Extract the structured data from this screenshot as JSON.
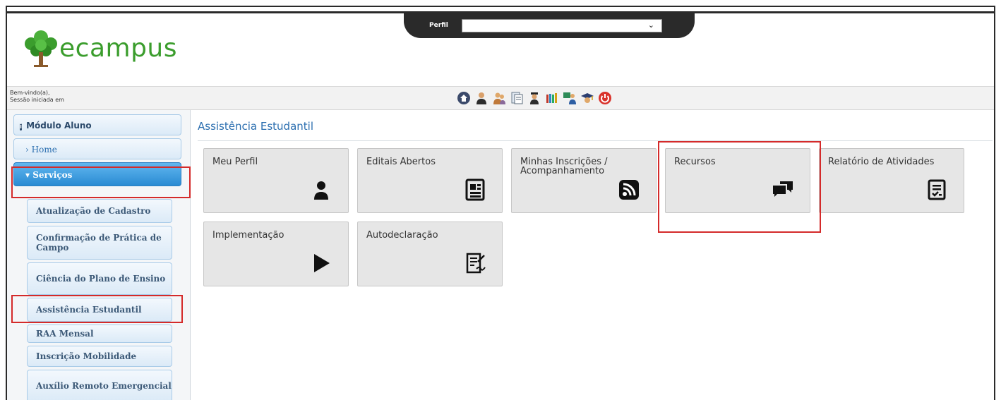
{
  "header": {
    "perfil_label": "Perfil",
    "perfil_value": "",
    "logo_text": "ecampus"
  },
  "welcome": {
    "line1": "Bem-vindo(a),",
    "line2": "Sessão iniciada em"
  },
  "toolbar": {
    "icons": [
      "home-icon",
      "user-icon",
      "users-icon",
      "document-icon",
      "graduate-icon",
      "books-icon",
      "teacher-icon",
      "cap-icon",
      "power-icon"
    ]
  },
  "sidebar": {
    "modulo": "Módulo Aluno",
    "home": "Home",
    "servicos": "Serviços",
    "items": [
      {
        "label": "Atualização de Cadastro"
      },
      {
        "label": "Confirmação de Prática de Campo"
      },
      {
        "label": "Ciência do Plano de Ensino"
      },
      {
        "label": "Assistência Estudantil"
      },
      {
        "label": "RAA Mensal"
      },
      {
        "label": "Inscrição Mobilidade"
      },
      {
        "label": "Auxílio Remoto Emergencial"
      }
    ]
  },
  "main": {
    "title": "Assistência Estudantil",
    "tiles": [
      {
        "label": "Meu Perfil",
        "icon": "person-icon"
      },
      {
        "label": "Editais Abertos",
        "icon": "newspaper-icon"
      },
      {
        "label": "Minhas Inscrições / Acompanhamento",
        "icon": "rss-icon"
      },
      {
        "label": "Recursos",
        "icon": "chat-bubbles-icon"
      },
      {
        "label": "Relatório de Atividades",
        "icon": "checklist-icon"
      },
      {
        "label": "Implementação",
        "icon": "play-icon"
      },
      {
        "label": "Autodeclaração",
        "icon": "signed-document-icon"
      }
    ]
  },
  "colors": {
    "brand_green": "#3b9d2d",
    "accent_blue": "#2a8bd3",
    "highlight_red": "#d42a2a"
  }
}
